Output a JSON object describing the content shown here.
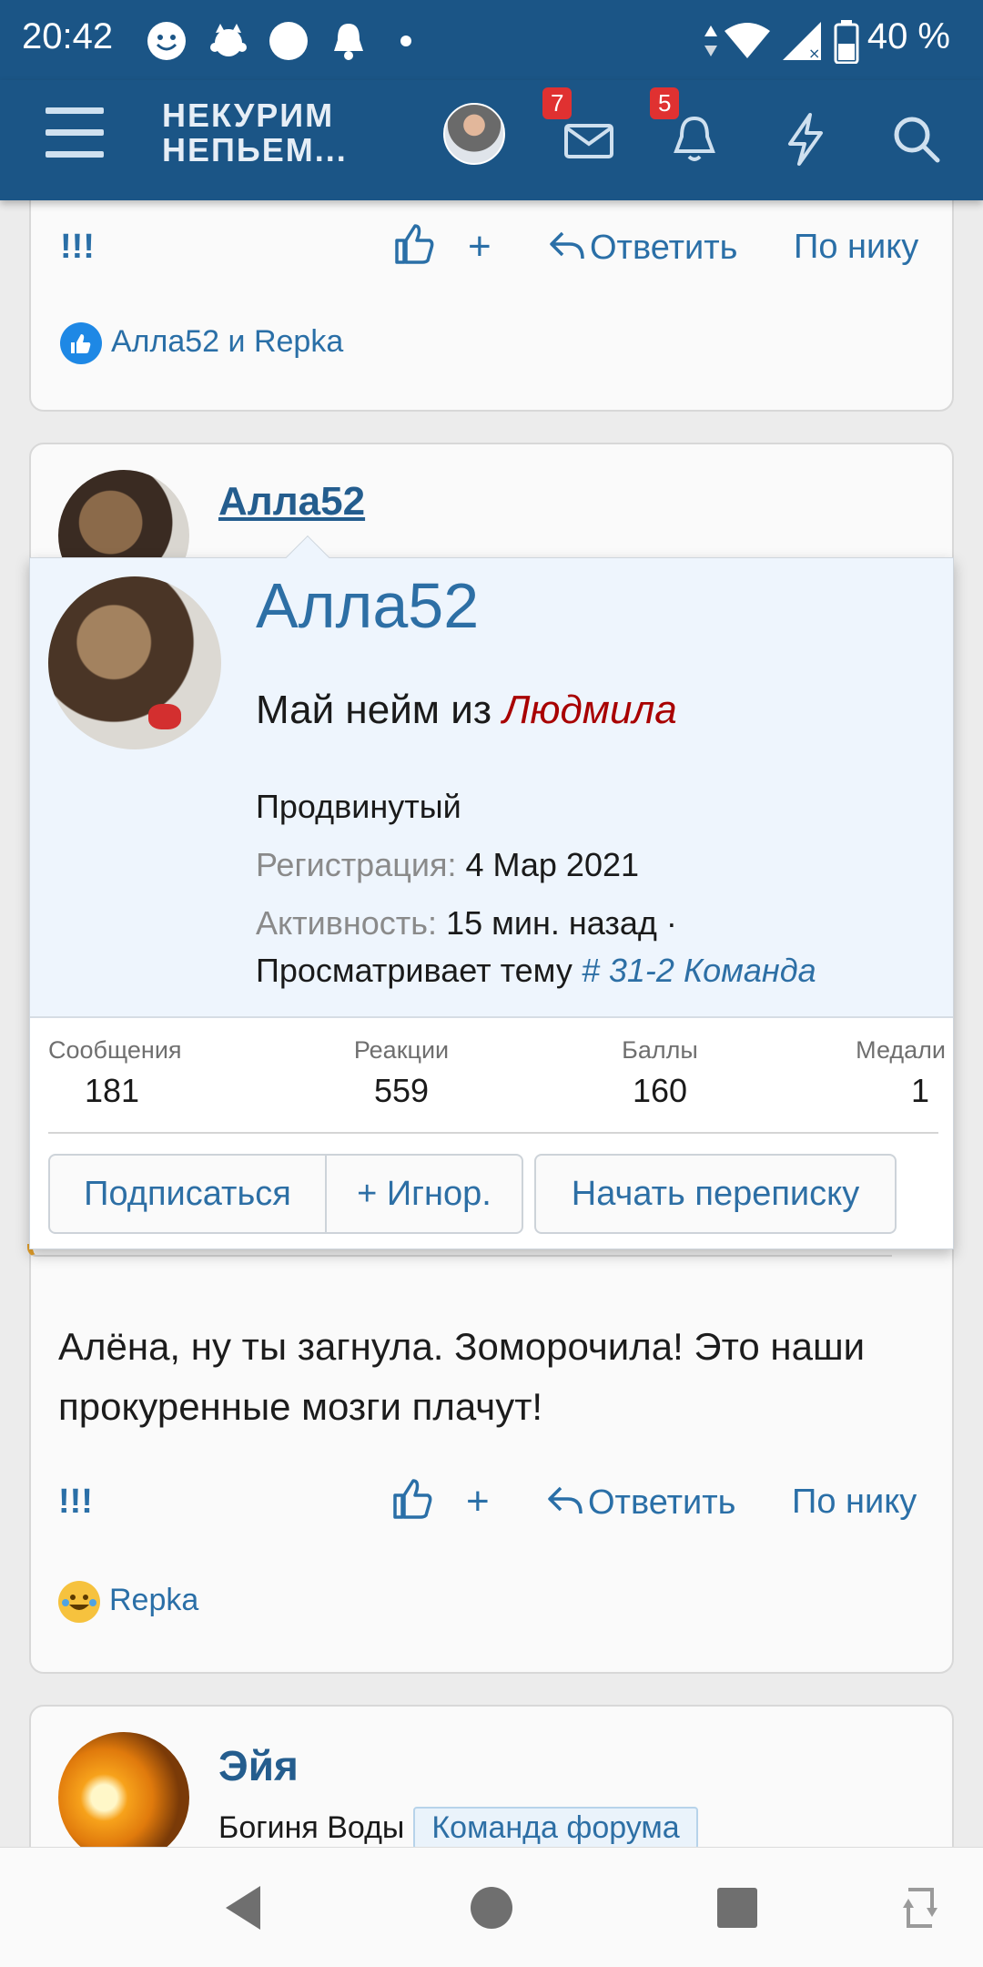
{
  "status_bar": {
    "time": "20:42",
    "battery": "40 %",
    "icons": [
      "emoji-icon",
      "cat-icon",
      "dot-icon",
      "bell-icon",
      "dot-small-icon",
      "data-arrows-icon",
      "wifi-icon",
      "signal-icon",
      "battery-icon"
    ]
  },
  "header": {
    "logo_line1": "НЕКУРИМ",
    "logo_line2": "НЕПЬЕМ...",
    "mail_badge": "7",
    "alerts_badge": "5"
  },
  "post_prev": {
    "bang": "!!!",
    "plus": "+",
    "reply": "Ответить",
    "by_nick": "По нику",
    "reactions_text": "Алла52 и Repka"
  },
  "post_main": {
    "author": "Алла52",
    "text": "Алёна, ну ты загнула. Зоморочила! Это наши прокуренные мозги плачут!",
    "bang": "!!!",
    "plus": "+",
    "reply": "Ответить",
    "by_nick": "По нику",
    "reactions_text": "Repka"
  },
  "popup": {
    "name": "Алла52",
    "title_prefix": "Май нейм из",
    "title_city": "Людмила",
    "rank": "Продвинутый",
    "reg_label": "Регистрация:",
    "reg_value": "4 Мар 2021",
    "act_label": "Активность:",
    "act_value": "15 мин. назад ·",
    "viewing_prefix": "Просматривает тему",
    "viewing_link": "# 31-2 Команда",
    "stats": [
      {
        "label": "Сообщения",
        "value": "181"
      },
      {
        "label": "Реакции",
        "value": "559"
      },
      {
        "label": "Баллы",
        "value": "160"
      },
      {
        "label": "Медали",
        "value": "1"
      }
    ],
    "btn_follow": "Подписаться",
    "btn_ignore": "+ Игнор.",
    "btn_message": "Начать переписку"
  },
  "post_next": {
    "author": "Эйя",
    "subtitle": "Богиня Воды",
    "badge": "Команда форума"
  },
  "colors": {
    "header_bg": "#1b5586",
    "link": "#2d6fa5",
    "popup_bg": "#eef5fd",
    "badge_red": "#e03131",
    "city_red": "#a80000"
  }
}
